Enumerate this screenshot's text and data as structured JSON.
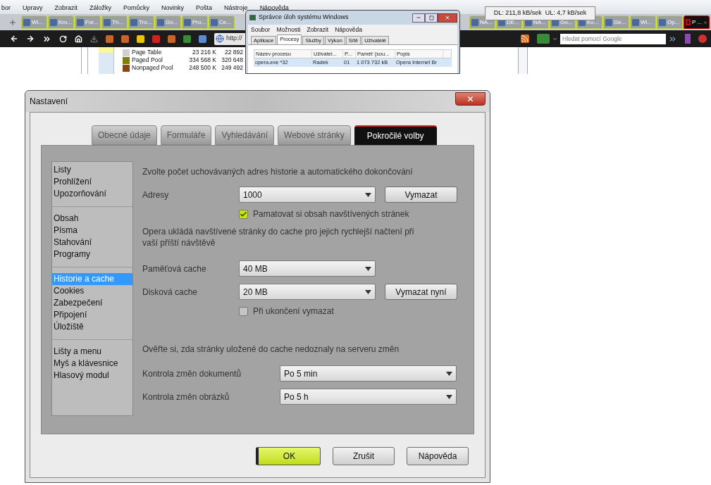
{
  "browser": {
    "menu": [
      "bor",
      "Upravy",
      "Zobrazit",
      "Záložky",
      "Pomůcky",
      "Novinky",
      "Pošta",
      "Nástroje",
      "Nápověda"
    ],
    "tab_groups": [
      [
        {
          "label": "Wi...",
          "selected": false
        },
        {
          "label": "Kru...",
          "selected": false
        },
        {
          "label": "For...",
          "selected": false
        },
        {
          "label": "Th...",
          "selected": false
        },
        {
          "label": "Tro...",
          "selected": false
        },
        {
          "label": "Go...",
          "selected": false
        },
        {
          "label": "Pro...",
          "selected": false
        },
        {
          "label": "Ce...",
          "selected": false
        }
      ],
      [
        {
          "label": "NA...",
          "selected": false
        },
        {
          "label": "DE...",
          "selected": false
        },
        {
          "label": "NA...",
          "selected": false
        },
        {
          "label": "Go...",
          "selected": false
        },
        {
          "label": "Ko...",
          "selected": false
        },
        {
          "label": "Ge...",
          "selected": false
        },
        {
          "label": "Wi...",
          "selected": false
        },
        {
          "label": "Op...",
          "selected": false
        },
        {
          "label": "P ...",
          "selected": true
        }
      ]
    ],
    "address": "http://",
    "search": {
      "placeholder": "Hledat pomocí Google"
    }
  },
  "transfer_tooltip": "DL: 211,8 kB/sek  UL: 4,7 kB/sek",
  "memory_table": [
    {
      "name": "Page Table",
      "color": "#d0d0d0",
      "value_1": "23 216 K",
      "value_2": "22 892"
    },
    {
      "name": "Paged Pool",
      "color": "#808000",
      "value_1": "334 568 K",
      "value_2": "320 648"
    },
    {
      "name": "Nonpaged Pool",
      "color": "#8b4513",
      "value_1": "248 500 K",
      "value_2": "249 492"
    }
  ],
  "task_manager": {
    "title": "Správce úloh systému Windows",
    "menu": [
      "Soubor",
      "Možnosti",
      "Zobrazit",
      "Nápověda"
    ],
    "tabs": [
      {
        "label": "Aplikace",
        "selected": false
      },
      {
        "label": "Procesy",
        "selected": true
      },
      {
        "label": "Služby",
        "selected": false
      },
      {
        "label": "Výkon",
        "selected": false
      },
      {
        "label": "Sítě",
        "selected": false
      },
      {
        "label": "Uživatelé",
        "selected": false
      }
    ],
    "columns": [
      "Název procesu",
      "Uživatel...",
      "P...",
      "Paměť (sou...",
      "Popis"
    ],
    "rows": [
      {
        "cells": [
          "opera.exe *32",
          "Radek",
          "01",
          "1 073 732 kB",
          "Opera Internet Br"
        ],
        "selected": true
      }
    ]
  },
  "dialog": {
    "title": "Nastavení",
    "tabs": [
      {
        "label": "Obecné údaje",
        "selected": false
      },
      {
        "label": "Formuláře",
        "selected": false
      },
      {
        "label": "Vyhledávání",
        "selected": false
      },
      {
        "label": "Webové stránky",
        "selected": false
      },
      {
        "label": "Pokročilé volby",
        "selected": true
      }
    ],
    "sidebar_groups": [
      [
        {
          "label": "Listy",
          "selected": false
        },
        {
          "label": "Prohlížení",
          "selected": false
        },
        {
          "label": "Upozorňování",
          "selected": false
        }
      ],
      [
        {
          "label": "Obsah",
          "selected": false
        },
        {
          "label": "Písma",
          "selected": false
        },
        {
          "label": "Stahování",
          "selected": false
        },
        {
          "label": "Programy",
          "selected": false
        }
      ],
      [
        {
          "label": "Historie a cache",
          "selected": true
        },
        {
          "label": "Cookies",
          "selected": false
        },
        {
          "label": "Zabezpečení",
          "selected": false
        },
        {
          "label": "Připojení",
          "selected": false
        },
        {
          "label": "Úložiště",
          "selected": false
        }
      ],
      [
        {
          "label": "Lišty a menu",
          "selected": false
        },
        {
          "label": "Myš a klávesnice",
          "selected": false
        },
        {
          "label": "Hlasový modul",
          "selected": false
        }
      ]
    ],
    "history": {
      "heading": "Zvolte počet uchovávaných adres historie a automatického dokončování",
      "label": "Adresy",
      "value": "1000",
      "button": "Vymazat",
      "checkbox": {
        "label": "Pamatovat si obsah navštívených stránek",
        "checked": true
      }
    },
    "cache": {
      "description": "Opera ukládá navštívené stránky do cache pro jejich rychlejší načtení při vaší příští návštěvě",
      "memory": {
        "label": "Paměťová cache",
        "value": "40 MB"
      },
      "disk": {
        "label": "Disková cache",
        "value": "20 MB",
        "button": "Vymazat nyní"
      },
      "checkbox": {
        "label": "Při ukončení vymazat",
        "checked": false
      }
    },
    "check": {
      "heading": "Ověřte si, zda stránky uložené do cache nedoznaly na serveru změn",
      "rows": [
        {
          "label": "Kontrola změn dokumentů",
          "value": "Po 5 min"
        },
        {
          "label": "Kontrola změn obrázků",
          "value": "Po 5 h"
        }
      ]
    },
    "buttons": [
      {
        "label": "OK",
        "kind": "default"
      },
      {
        "label": "Zrušit",
        "kind": "normal"
      },
      {
        "label": "Nápověda",
        "kind": "normal"
      }
    ]
  }
}
